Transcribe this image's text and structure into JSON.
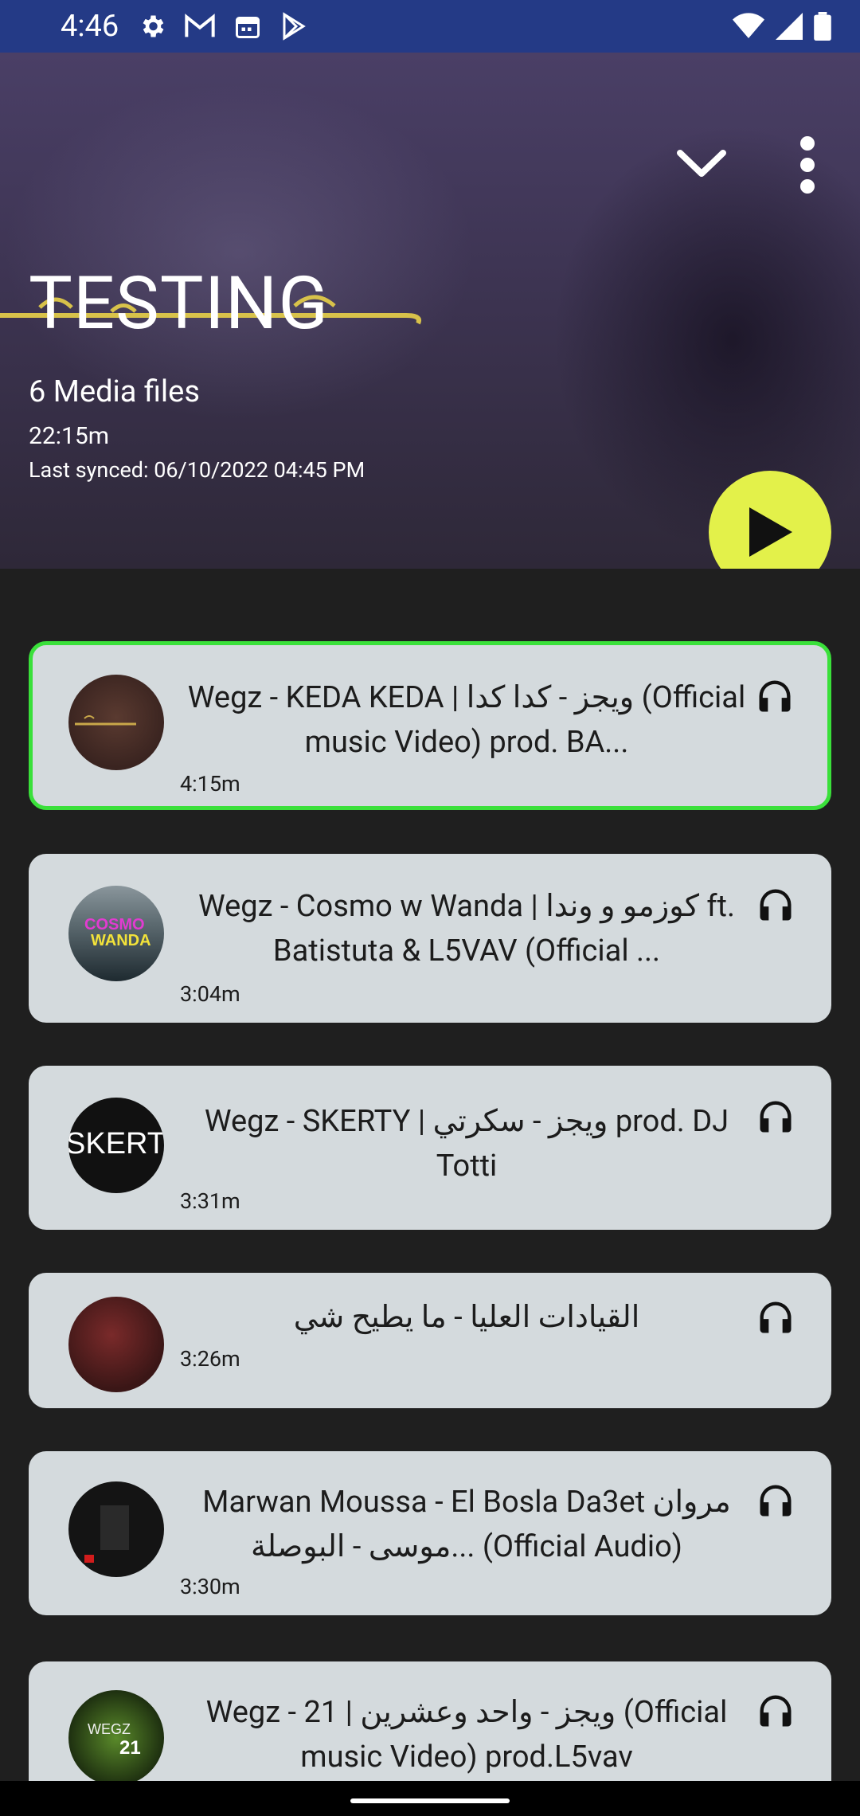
{
  "status_bar": {
    "time": "4:46",
    "icons": [
      "settings-icon",
      "gmail-icon",
      "calendar-icon",
      "play-store-icon"
    ],
    "right_icons": [
      "wifi-icon",
      "signal-icon",
      "battery-icon"
    ]
  },
  "playlist": {
    "title": "TESTING",
    "media_count": "6 Media files",
    "total_duration": "22:15m",
    "last_synced": "Last synced: 06/10/2022 04:45 PM"
  },
  "colors": {
    "accent_fab": "#e3f14a",
    "selected_border": "#3ae03a",
    "status_bar": "#243a86",
    "card_bg": "#d4dadd"
  },
  "tracks": [
    {
      "title": "Wegz - KEDA KEDA  | ويجز - كدا كدا (Official music Video) prod. BA...",
      "duration": "4:15m",
      "selected": true
    },
    {
      "title": "Wegz - Cosmo w Wanda |  كوزمو و وندا  ft. Batistuta & L5VAV (Official ...",
      "duration": "3:04m",
      "selected": false
    },
    {
      "title": "Wegz - SKERTY | ويجز - سكرتي prod. DJ Totti",
      "duration": "3:31m",
      "selected": false
    },
    {
      "title": "القيادات العليا - ما يطيح شي",
      "duration": "3:26m",
      "selected": false
    },
    {
      "title": "Marwan Moussa - El Bosla Da3et مروان موسى - البوصلة... (Official Audio)",
      "duration": "3:30m",
      "selected": false
    },
    {
      "title": "Wegz - 21 | ويجز - واحد وعشرين (Official music Video) prod.L5vav",
      "duration": "",
      "selected": false
    }
  ]
}
